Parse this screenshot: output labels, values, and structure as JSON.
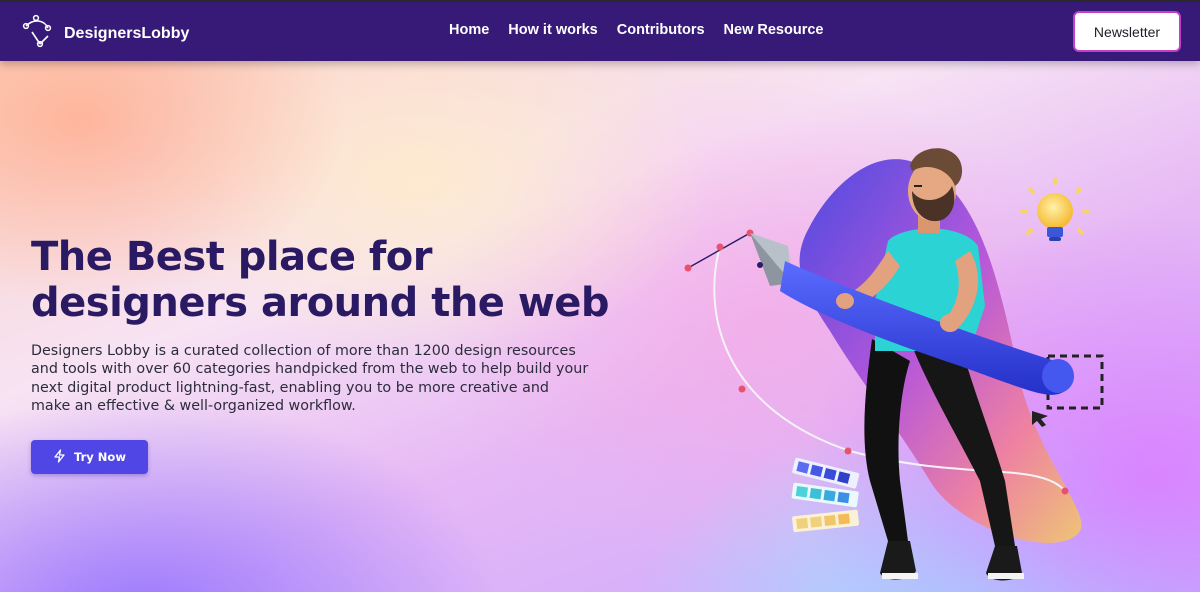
{
  "brand": {
    "name": "DesignersLobby",
    "logo_icon": "pen-tool-bezier-icon"
  },
  "nav": {
    "links": [
      {
        "label": "Home"
      },
      {
        "label": "How it works"
      },
      {
        "label": "Contributors"
      },
      {
        "label": "New Resource"
      }
    ],
    "cta_label": "Newsletter"
  },
  "hero": {
    "title_line1": "The Best place for",
    "title_line2": "designers around the web",
    "description": "Designers Lobby is a curated collection of more than 1200 design resources and tools with over 60 categories handpicked from the web to help build your next digital product lightning-fast, enabling you to be more creative and make an effective & well-organized workflow.",
    "button_label": "Try Now",
    "button_icon": "lightning-icon",
    "illustration": "designer-with-pen-tool-illustration"
  },
  "colors": {
    "navbar": "#371a78",
    "title": "#2a1a64",
    "button": "#4f46e5",
    "newsletter_border": "#c23ec7"
  }
}
